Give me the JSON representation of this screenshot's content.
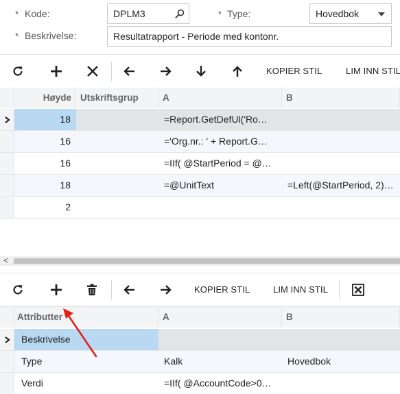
{
  "form": {
    "kode_label": "Kode:",
    "kode_value": "DPLM3",
    "type_label": "Type:",
    "type_value": "Hovedbok",
    "beskrivelse_label": "Beskrivelse:",
    "beskrivelse_value": "Resultatrapport - Periode med kontonr.",
    "required_marker": "*"
  },
  "toolbar1": {
    "copy_style": "KOPIER STIL",
    "paste_style": "LIM INN STIL"
  },
  "grid1": {
    "columns": [
      "Høyde",
      "Utskriftsgrup",
      "A",
      "B"
    ],
    "rows": [
      {
        "hoyde": "18",
        "utskrift": "",
        "a": "=Report.GetDefUl('Ro…",
        "b": ""
      },
      {
        "hoyde": "16",
        "utskrift": "",
        "a": "='Org.nr.: ' + Report.G…",
        "b": ""
      },
      {
        "hoyde": "16",
        "utskrift": "",
        "a": "=IIf( @StartPeriod = @…",
        "b": ""
      },
      {
        "hoyde": "18",
        "utskrift": "",
        "a": "=@UnitText",
        "b": "=Left(@StartPeriod, 2)…"
      },
      {
        "hoyde": "2",
        "utskrift": "",
        "a": "",
        "b": ""
      }
    ],
    "scroll_left_glyph": "<"
  },
  "toolbar2": {
    "copy_style": "KOPIER STIL",
    "paste_style": "LIM INN STIL"
  },
  "grid2": {
    "columns": [
      "Attributter",
      "A",
      "B"
    ],
    "rows": [
      {
        "attr": "Beskrivelse",
        "a": "",
        "b": ""
      },
      {
        "attr": "Type",
        "a": "Kalk",
        "b": "Hovedbok"
      },
      {
        "attr": "Verdi",
        "a": "=IIf( @AccountCode>0…",
        "b": ""
      }
    ]
  },
  "colors": {
    "selected_cell": "#b9d8f2",
    "selected_row": "#e3e4e6",
    "alt_row": "#f4f7fb",
    "annotation_arrow": "#e0201a"
  }
}
